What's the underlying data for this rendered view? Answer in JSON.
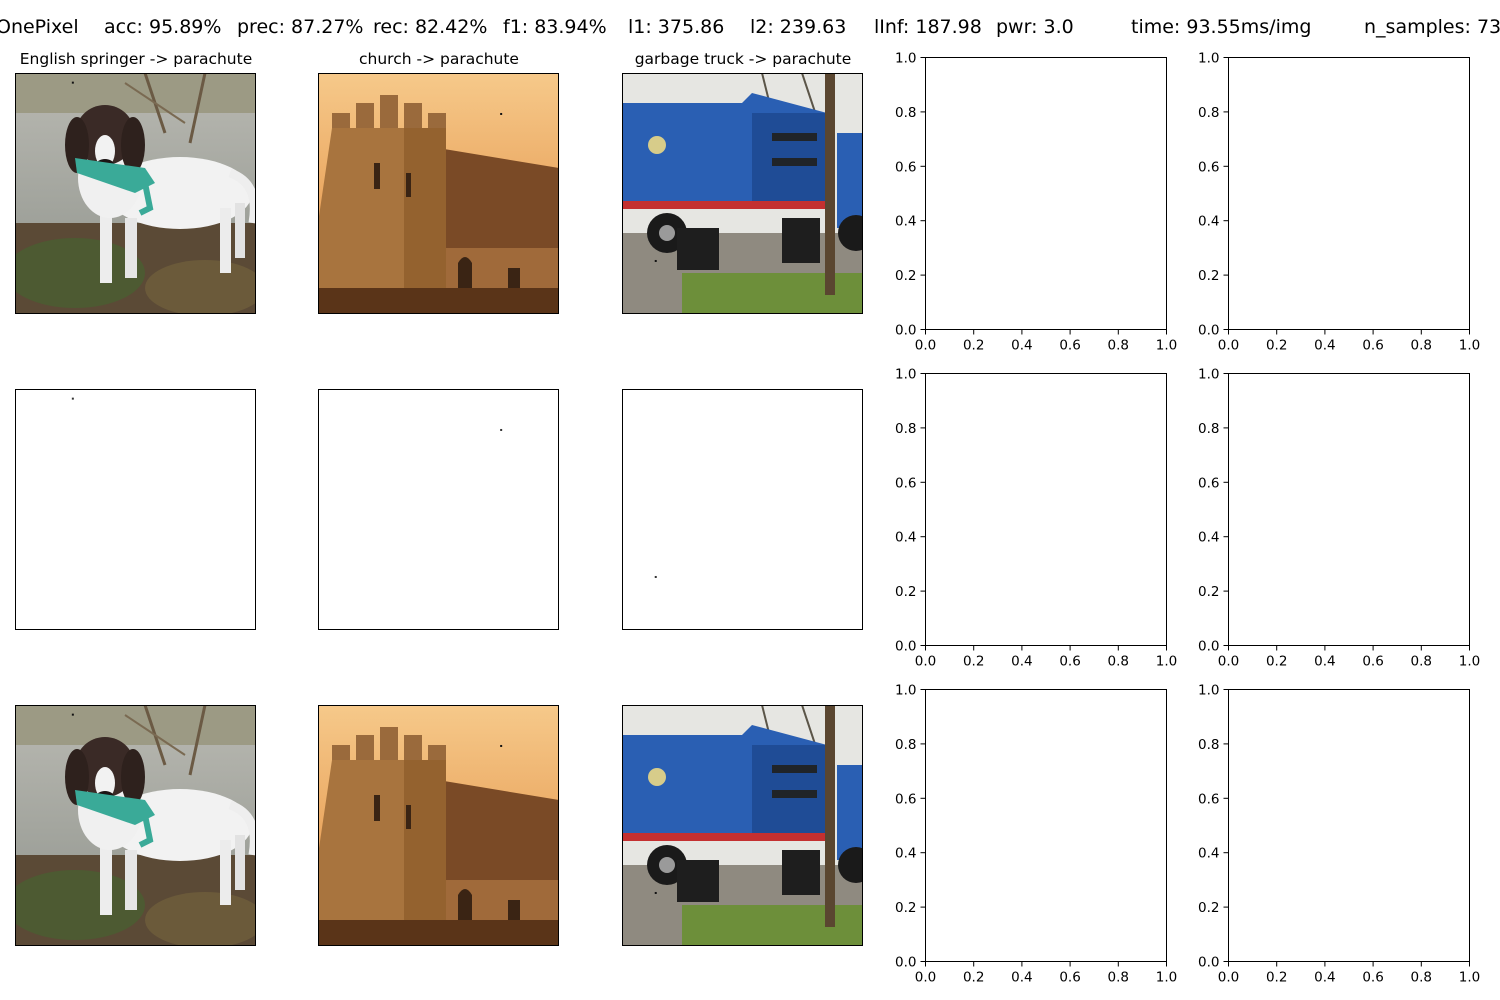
{
  "suptitle": {
    "attack": "OnePixel",
    "acc": "acc: 95.89%",
    "prec": "prec: 87.27%",
    "rec": "rec: 82.42%",
    "f1": "f1: 83.94%",
    "l1": "l1: 375.86",
    "l2": "l2: 239.63",
    "linf": "lInf: 187.98",
    "pwr": "pwr: 3.0",
    "time": "time: 93.55ms/img",
    "n_samples": "n_samples: 73"
  },
  "panel_titles": [
    "English springer -> parachute",
    "church -> parachute",
    "garbage truck -> parachute"
  ],
  "image_columns": [
    {
      "subject": "english-springer",
      "perturbation_pixel": [
        0.24,
        0.04
      ]
    },
    {
      "subject": "church",
      "perturbation_pixel": [
        0.76,
        0.17
      ]
    },
    {
      "subject": "garbage-truck",
      "perturbation_pixel": [
        0.14,
        0.78
      ]
    }
  ],
  "chart_data": {
    "type": "grid",
    "rows": 3,
    "cols": 5,
    "empty_axes": {
      "xlim": [
        0.0,
        1.0
      ],
      "ylim": [
        0.0,
        1.0
      ],
      "xticks": [
        "0.0",
        "0.2",
        "0.4",
        "0.6",
        "0.8",
        "1.0"
      ],
      "yticks": [
        "0.0",
        "0.2",
        "0.4",
        "0.6",
        "0.8",
        "1.0"
      ],
      "grid": false
    },
    "row_roles": [
      "original image",
      "perturbation (difference)",
      "adversarial image"
    ]
  },
  "colors": {
    "sky": "#e9a159",
    "brick": "#8a5a2d",
    "truck_blue": "#2a5fb3",
    "grass": "#6d8f3a",
    "water": "#a8a8a0",
    "dog_white": "#f2f2f2",
    "toy_teal": "#3aaa98"
  }
}
